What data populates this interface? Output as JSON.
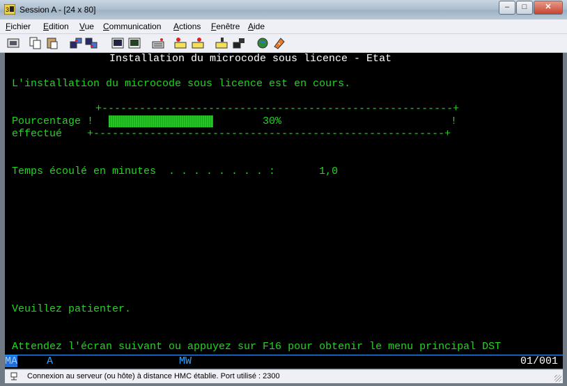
{
  "window": {
    "title": "Session A - [24 x 80]"
  },
  "menubar": {
    "items": [
      {
        "first": "F",
        "rest": "ichier"
      },
      {
        "first": "E",
        "rest": "dition"
      },
      {
        "first": "V",
        "rest": "ue"
      },
      {
        "first": "C",
        "rest": "ommunication"
      },
      {
        "first": "A",
        "rest": "ctions"
      },
      {
        "first": "F",
        "rest": "enêtre"
      },
      {
        "first": "A",
        "rest": "ide"
      }
    ]
  },
  "toolbar": {
    "icons": [
      "print-screen-icon",
      "copy-icon",
      "paste-icon",
      "send-file-icon",
      "receive-file-icon",
      "display-keypad-icon",
      "keyboard-map-icon",
      "macro-icon",
      "record-macro-icon",
      "play-macro-icon",
      "stop-macro-icon",
      "customize-icon",
      "globe-icon",
      "help-icon"
    ]
  },
  "terminal": {
    "header": "Installation du microcode sous licence - Etat",
    "message": "L'installation du microcode sous licence est en cours.",
    "border_top": "+--------------------------------------------------------+",
    "label_line1": "Pourcentage !",
    "percent_text": "30%",
    "right_bang": "!",
    "label_line2": "effectué    +--------------------------------------------------------+",
    "progress_value": 0.3,
    "elapsed_line": "Temps écoulé en minutes  . . . . . . . . :       1,0",
    "wait_message": "Veuillez patienter.",
    "bottom_message": "Attendez l'écran suivant ou appuyez sur F16 pour obtenir le menu principal DST"
  },
  "oia": {
    "ma": "MA",
    "a": "A",
    "mw": "MW",
    "cursor": "01/001"
  },
  "statusbar": {
    "text": "Connexion au serveur (ou hôte) à distance HMC établie. Port utilisé : 2300"
  },
  "colors": {
    "terminal_green": "#22d622",
    "terminal_bg": "#000000",
    "oia_blue": "#2aa4ff"
  }
}
